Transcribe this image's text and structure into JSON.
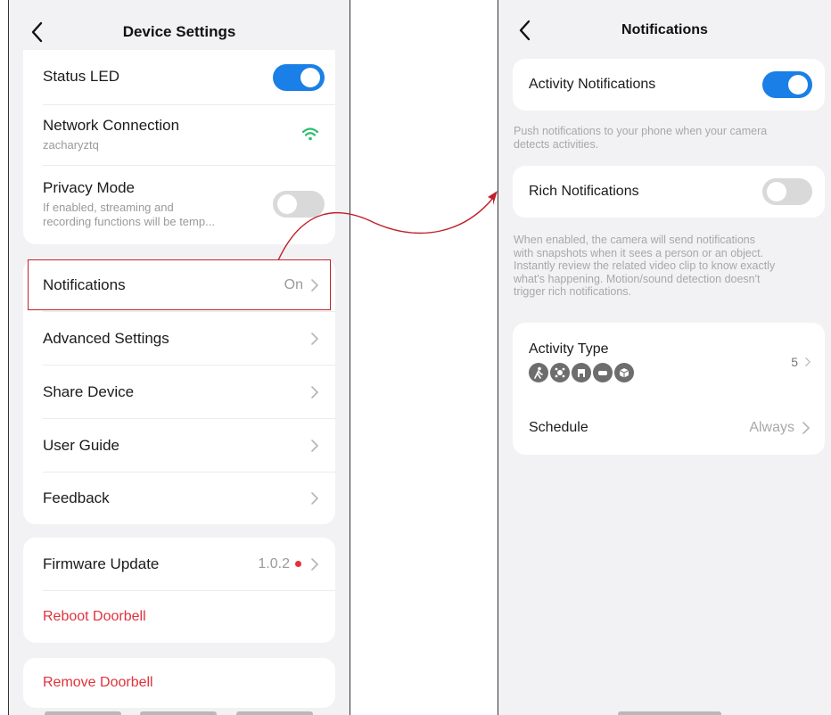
{
  "left": {
    "title": "Device Settings",
    "status_led": "Status LED",
    "network_label": "Network Connection",
    "network_name": "zacharyztq",
    "privacy_label": "Privacy Mode",
    "privacy_desc_1": "If enabled, streaming and",
    "privacy_desc_2": "recording functions will be temp...",
    "notifications_label": "Notifications",
    "notifications_value": "On",
    "advanced_label": "Advanced Settings",
    "share_label": "Share Device",
    "guide_label": "User Guide",
    "feedback_label": "Feedback",
    "firmware_label": "Firmware Update",
    "firmware_value": "1.0.2",
    "reboot_label": "Reboot Doorbell",
    "remove_label": "Remove Doorbell"
  },
  "right": {
    "title": "Notifications",
    "activity_label": "Activity Notifications",
    "activity_help_1": "Push notifications to your phone when your camera",
    "activity_help_2": "detects activities.",
    "rich_label": "Rich Notifications",
    "rich_help_1": "When enabled, the camera will send notifications",
    "rich_help_2": "with snapshots when it sees a person or an object.",
    "rich_help_3": "Instantly review the related video clip to know exactly",
    "rich_help_4": "what's happening. Motion/sound detection doesn't",
    "rich_help_5": "trigger rich notifications.",
    "activity_type_label": "Activity Type",
    "activity_type_value": "5",
    "schedule_label": "Schedule",
    "schedule_value": "Always"
  },
  "toggles": {
    "status_led": "on",
    "privacy_mode": "off",
    "activity_notifications": "on",
    "rich_notifications": "off"
  },
  "icons": {
    "activity_types": [
      "person-icon",
      "pet-icon",
      "vehicle-icon",
      "car-icon",
      "package-icon"
    ]
  },
  "colors": {
    "accent": "#1a7fe6",
    "danger": "#e0323c",
    "wifi": "#2bbf6b",
    "annotation": "#c0202a"
  }
}
